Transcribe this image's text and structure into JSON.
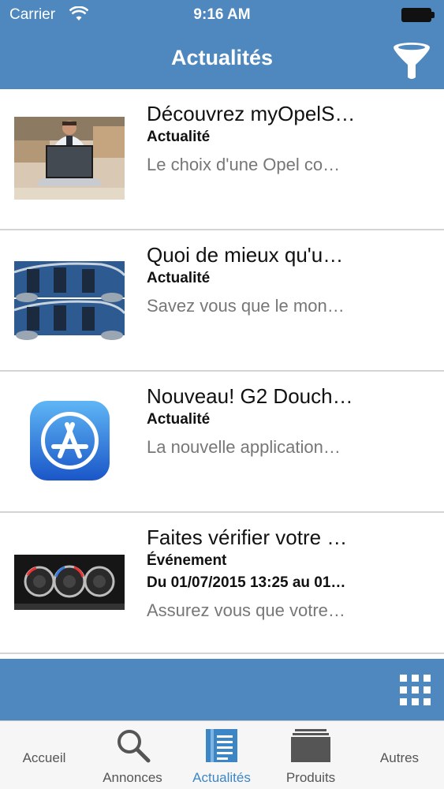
{
  "status": {
    "carrier": "Carrier",
    "time": "9:16 AM"
  },
  "nav": {
    "title": "Actualités"
  },
  "items": [
    {
      "title": "Découvrez myOpelS…",
      "category": "Actualité",
      "dates": "",
      "description": "Le choix d'une Opel co…",
      "thumb": "man-laptop-photo"
    },
    {
      "title": "Quoi de mieux qu'u…",
      "category": "Actualité",
      "dates": "",
      "description": "Savez vous que le mon…",
      "thumb": "car-interior-photo"
    },
    {
      "title": "Nouveau! G2 Douch…",
      "category": "Actualité",
      "dates": "",
      "description": "La nouvelle application…",
      "thumb": "app-store-icon"
    },
    {
      "title": "Faites vérifier votre …",
      "category": "Événement",
      "dates": "Du 01/07/2015 13:25 au 01…",
      "description": "Assurez vous que votre…",
      "thumb": "climate-control-photo"
    }
  ],
  "tabs": [
    {
      "label": "Accueil",
      "icon": "home-icon",
      "active": false
    },
    {
      "label": "Annonces",
      "icon": "search-icon",
      "active": false
    },
    {
      "label": "Actualités",
      "icon": "news-icon",
      "active": true
    },
    {
      "label": "Produits",
      "icon": "products-icon",
      "active": false
    },
    {
      "label": "Autres",
      "icon": "more-icon",
      "active": false
    }
  ],
  "colors": {
    "brand_blue": "#4f88be",
    "active_tab": "#3d86c6"
  }
}
